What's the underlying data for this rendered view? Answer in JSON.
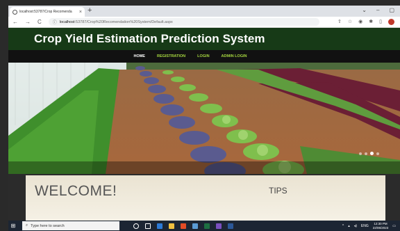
{
  "browser": {
    "tab_title": "localhost:53787/Crop Recomenda",
    "tab_close": "×",
    "new_tab": "+",
    "url_host": "localhost",
    "url_path": ":53787/Crop%20Recomendation%20System/Default.aspx",
    "back": "←",
    "forward": "→",
    "reload": "C",
    "home": "⌂",
    "min": "⌄",
    "minimize": "–",
    "restore": "▢"
  },
  "site": {
    "title": "Crop Yield Estimation Prediction System",
    "menu": [
      {
        "label": "HOME"
      },
      {
        "label": "REGISTRATION"
      },
      {
        "label": "LOGIN"
      },
      {
        "label": "ADMIN LOGIN"
      }
    ],
    "active_menu": "HOME",
    "welcome": "WELCOME!",
    "tips": "TIPS"
  },
  "slider": {
    "active_index": 2,
    "count": 4
  },
  "taskbar": {
    "search_placeholder": "Type here to search",
    "lang": "ENG",
    "time": "12:30 PM",
    "date": "22/06/2023"
  },
  "colors": {
    "header_bg": "#173a17",
    "menu_link": "#a5d63f",
    "menu_active": "#ffffff"
  }
}
